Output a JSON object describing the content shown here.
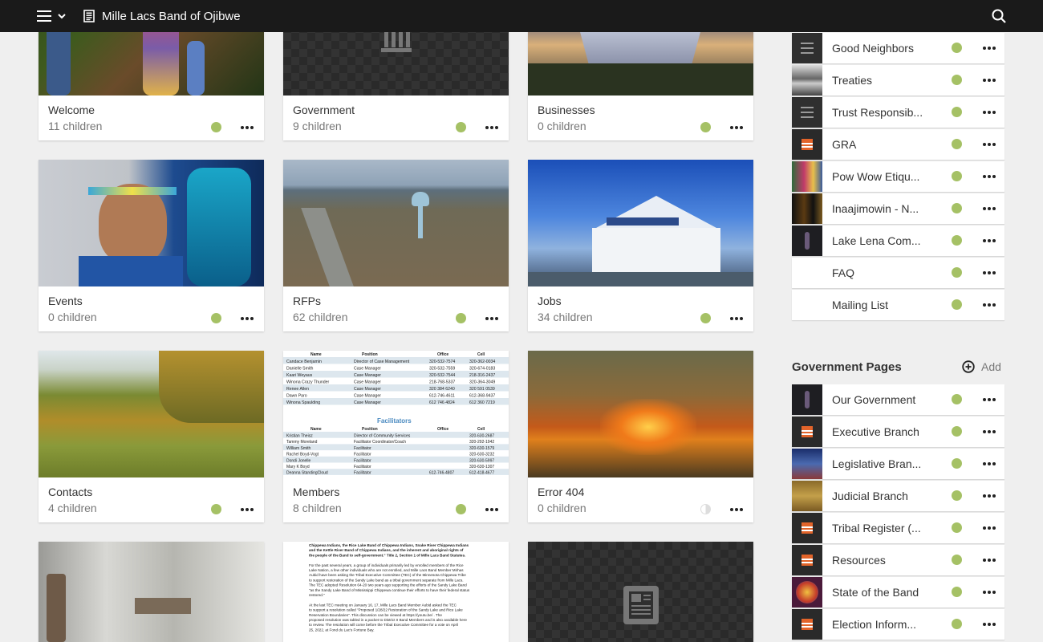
{
  "header": {
    "title": "Mille Lacs Band of Ojibwe"
  },
  "cards": [
    {
      "title": "Welcome",
      "sub": "11 children"
    },
    {
      "title": "Government",
      "sub": "9 children"
    },
    {
      "title": "Businesses",
      "sub": "0 children"
    },
    {
      "title": "Events",
      "sub": "0 children"
    },
    {
      "title": "RFPs",
      "sub": "62 children"
    },
    {
      "title": "Jobs",
      "sub": "34 children"
    },
    {
      "title": "Contacts",
      "sub": "4 children"
    },
    {
      "title": "Members",
      "sub": "8 children"
    },
    {
      "title": "Error 404",
      "sub": "0 children"
    }
  ],
  "members_doc": {
    "top_header": [
      "Name",
      "Position",
      "Office",
      "Cell"
    ],
    "top_rows": [
      [
        "Candace Benjamin",
        "Director of Case Management",
        "320-532-7574",
        "320-362-0034"
      ],
      [
        "Danielle Smith",
        "Case Manager",
        "320-532-7559",
        "320-674-0183"
      ],
      [
        "Kaari Weyaus",
        "Case Manager",
        "320-532-7544",
        "218-316-2437"
      ],
      [
        "Winona Crazy Thunder",
        "Case Manager",
        "218-768-5337",
        "320-364-3049"
      ],
      [
        "Renee Allen",
        "Case Manager",
        "320 384 6240",
        "320 591 0539"
      ],
      [
        "Dawn Paro",
        "Case Manager",
        "612-746-4611",
        "612-368-9437"
      ],
      [
        "Winona Spaulding",
        "Case Manager",
        "612 746 4824",
        "612 360 7219"
      ]
    ],
    "heading": "Facilitators",
    "bottom_header": [
      "Name",
      "Position",
      "Office",
      "Cell"
    ],
    "bottom_rows": [
      [
        "Kristian Theisz",
        "Director of Community Services",
        "",
        "320-630-2687"
      ],
      [
        "Tammy Moreland",
        "Facilitator Coordinator/Coach",
        "",
        "320-292-1942"
      ],
      [
        "William Smith",
        "Facilitator",
        "",
        "320-630-1579"
      ],
      [
        "Rachel Boyd-Vogt",
        "Facilitator",
        "",
        "320-630-3232"
      ],
      [
        "Dondi Jonelle",
        "Facilitator",
        "",
        "320-630-5997"
      ],
      [
        "Mary K Boyd",
        "Facilitator",
        "",
        "320-630-1307"
      ],
      [
        "Deanna StandingCloud",
        "Facilitator",
        "612-746-4807",
        "612-418-4677"
      ]
    ]
  },
  "doc_card": {
    "lines": [
      "Chippewa Indians, the Rice Lake Band of Chippewa Indians, Snake River Chippewa Indians",
      "and the Kettle River Band of Chippewa Indians, and the inherent and aboriginal rights of",
      "the people of the Band to self-government.\" Title 2, Section 1 of Mille Lacs Band Statutes.",
      "",
      "For the past several years, a group of individuals primarily led by enrolled members of the Rice",
      "Lake Nation, a few other individuals who are not enrolled, and Mille Lacs Band Member Mirhas",
      "Aubid have been asking the Tribal Executive Committee (TEC) of the Minnesota Chippewa Tribe",
      "to support restoration of the Sandy Lake band as a tribal government separate from Mille Lacs.",
      "The TEC adopted Resolution 64-20 two years ago supporting the efforts of the Sandy Lake Band",
      "\"as the Sandy Lake Band of Mississippi Chippewa continue their efforts to have their federal status",
      "restored.\"",
      "",
      "At the last TEC meeting on January 16, 17, Mille Lacs Band Member Aubid asked the TEC",
      "to support a resolution called \"Proposed 1/28/22 Restoration of the Sandy Lake and Rice Lake",
      "Reservation Boundaries\". This discussion can be viewed at https://youtu.be/ . The",
      "proposed resolution was tabled in a packet to District II Band Members and is also available here",
      "to review. The resolution will come before the Tribal Executive Committee for a vote on April",
      "25, 2022, at Fond du Lac's Fortune Bay."
    ]
  },
  "top_list": [
    {
      "label": "Good Neighbors",
      "thumb": "lines"
    },
    {
      "label": "Treaties",
      "thumb": "photo-bw"
    },
    {
      "label": "Trust Responsib...",
      "thumb": "lines"
    },
    {
      "label": "GRA",
      "thumb": "logo"
    },
    {
      "label": "Pow Wow Etiqu...",
      "thumb": "photo-powwow"
    },
    {
      "label": "Inaajimowin - N...",
      "thumb": "photo-dark"
    },
    {
      "label": "Lake Lena Com...",
      "thumb": "photo-dark2"
    },
    {
      "label": "FAQ",
      "thumb": "none"
    },
    {
      "label": "Mailing List",
      "thumb": "none"
    }
  ],
  "gov_section": {
    "title": "Government Pages",
    "add_label": "Add",
    "items": [
      {
        "label": "Our Government",
        "thumb": "photo-dark2"
      },
      {
        "label": "Executive Branch",
        "thumb": "logo"
      },
      {
        "label": "Legislative Bran...",
        "thumb": "photo-blue"
      },
      {
        "label": "Judicial Branch",
        "thumb": "photo-field"
      },
      {
        "label": "Tribal Register (...",
        "thumb": "logo"
      },
      {
        "label": "Resources",
        "thumb": "logo"
      },
      {
        "label": "State of the Band",
        "thumb": "photo-seal"
      },
      {
        "label": "Election Inform...",
        "thumb": "logo"
      }
    ]
  },
  "colors": {
    "topbar": "#1a1a1a",
    "status_dot": "#a5c165",
    "background": "#efefef"
  }
}
